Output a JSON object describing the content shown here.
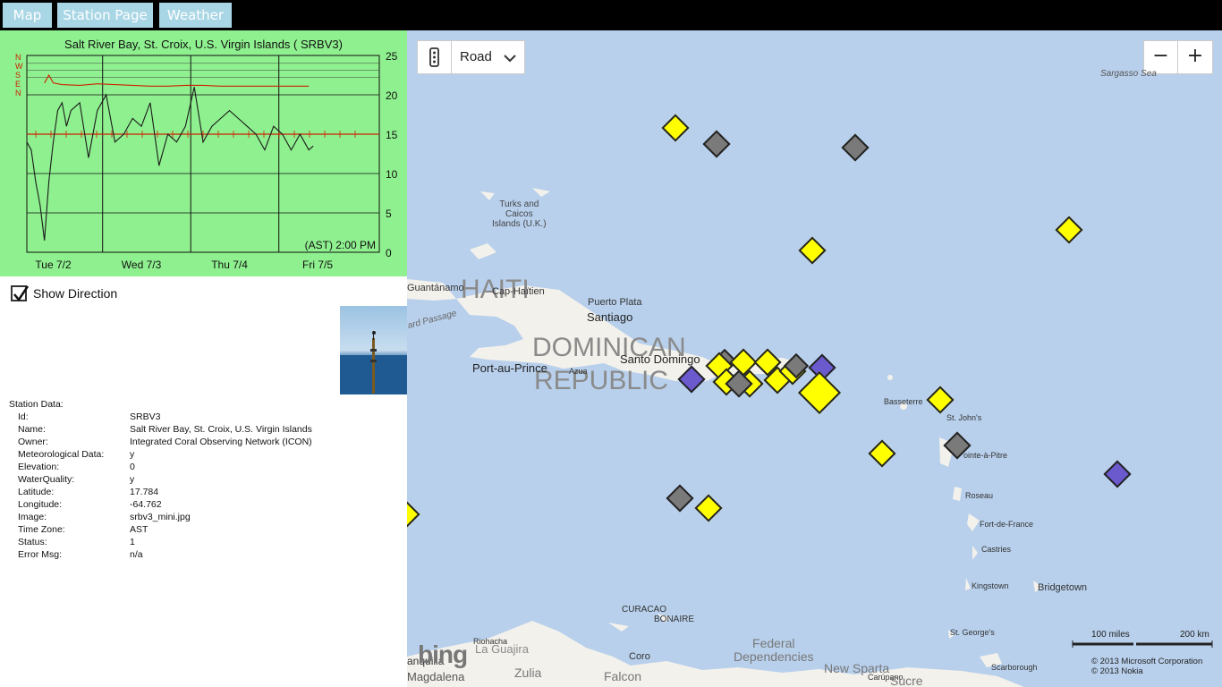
{
  "nav": {
    "map_label": "Map",
    "station_label": "Station Page",
    "weather_label": "Weather"
  },
  "chart_data": {
    "type": "line",
    "title": "Salt River Bay, St. Croix, U.S. Virgin Islands ( SRBV3)",
    "y_ticks": [
      "25",
      "20",
      "15",
      "10",
      "5",
      "0"
    ],
    "ylim": [
      0,
      25
    ],
    "x_ticks": [
      "Tue   7/2",
      "Wed   7/3",
      "Thu   7/4",
      "Fri   7/5"
    ],
    "direction_labels": [
      "N",
      "W",
      "S",
      "E",
      "N"
    ],
    "timestamp": "(AST) 2:00 PM",
    "series": [
      {
        "color": "#1a1a1a",
        "x": [
          0,
          0.05,
          0.1,
          0.15,
          0.2,
          0.25,
          0.3,
          0.35,
          0.4,
          0.45,
          0.5,
          0.6,
          0.7,
          0.8,
          0.9,
          1.0,
          1.1,
          1.2,
          1.3,
          1.4,
          1.5,
          1.6,
          1.7,
          1.8,
          1.9,
          2.0,
          2.1,
          2.2,
          2.3,
          2.4,
          2.5,
          2.6,
          2.7,
          2.8,
          2.9,
          3.0,
          3.1,
          3.15,
          3.2,
          3.25
        ],
        "y": [
          14,
          13,
          9,
          6,
          1.5,
          9,
          14,
          18,
          19,
          16,
          18,
          19,
          12,
          18,
          20,
          14,
          15,
          17,
          16,
          19,
          11,
          15,
          14,
          16,
          21,
          14,
          16,
          17,
          18,
          17,
          16,
          15,
          13,
          16,
          15,
          13,
          15,
          14,
          13,
          13.5
        ]
      },
      {
        "color": "#cc2200",
        "x": [
          0.2,
          0.25,
          0.3,
          0.4,
          0.6,
          0.8,
          1.0,
          1.2,
          1.4,
          1.6,
          1.8,
          2.0,
          2.2,
          2.4,
          2.6,
          2.8,
          3.0,
          3.2
        ],
        "y": [
          21.5,
          22.5,
          21.5,
          21.3,
          21.2,
          21.4,
          21.3,
          21.2,
          21.1,
          21.1,
          21.2,
          21.2,
          21.1,
          21.1,
          21.1,
          21.1,
          21.1,
          21.1
        ]
      }
    ],
    "ref_line": 15
  },
  "show_direction": {
    "label": "Show Direction",
    "checked": true
  },
  "station": {
    "header": "Station Data:",
    "rows": [
      {
        "key": "Id:",
        "val": "SRBV3"
      },
      {
        "key": "Name:",
        "val": "Salt River Bay, St. Croix, U.S. Virgin Islands"
      },
      {
        "key": "Owner:",
        "val": "Integrated Coral Observing Network (ICON)"
      },
      {
        "key": "Meteorological Data:",
        "val": "y"
      },
      {
        "key": "Elevation:",
        "val": "0"
      },
      {
        "key": "WaterQuality:",
        "val": "y"
      },
      {
        "key": "Latitude:",
        "val": "17.784"
      },
      {
        "key": "Longitude:",
        "val": "-64.762"
      },
      {
        "key": "Image:",
        "val": "srbv3_mini.jpg"
      },
      {
        "key": "Time Zone:",
        "val": "AST"
      },
      {
        "key": "Status:",
        "val": "1"
      },
      {
        "key": "Error Msg:",
        "val": "n/a"
      }
    ]
  },
  "map": {
    "style_value": "Road",
    "zoom_out": "−",
    "zoom_in": "+",
    "labels": {
      "sargasso": "Sargasso Sea",
      "turks": "Turks and\nCaicos\nIslands (U.K.)",
      "haiti": "HAITI",
      "dominican1": "DOMINICAN",
      "dominican2": "REPUBLIC",
      "guantanamo": "Guantánamo",
      "cap_haitien": "Cap-Haïtien",
      "puerto_plata": "Puerto Plata",
      "santiago": "Santiago",
      "windward": "ard Passage",
      "port_au_prince": "Port-au-Prince",
      "azua": "Azua",
      "santo_domingo": "Santo Domingo",
      "basseterre": "Basseterre",
      "st_johns": "St. John's",
      "pointe": "ointe-à-Pitre",
      "roseau": "Roseau",
      "fort_de_france": "Fort-de-France",
      "castries": "Castries",
      "kingstown": "Kingstown",
      "bridgetown": "Bridgetown",
      "st_georges": "St. George's",
      "curacao": "CURACAO",
      "bonaire": "BONAIRE",
      "riohacha": "Riohacha",
      "la_guajira": "La Guajira",
      "coro": "Coro",
      "federal": "Federal\nDependencies",
      "new_sparta": "New Sparta",
      "scarborough": "Scarborough",
      "carupano": "Carúpano",
      "anquilla": "anquilla",
      "magdalena": "Magdalena",
      "zulia": "Zulia",
      "falcon": "Falcon",
      "sucre": "Sucre"
    },
    "scale_miles": "100 miles",
    "scale_km": "200 km",
    "copyright1": "© 2013 Microsoft Corporation",
    "copyright2": "© 2013 Nokia",
    "logo": "bing"
  }
}
